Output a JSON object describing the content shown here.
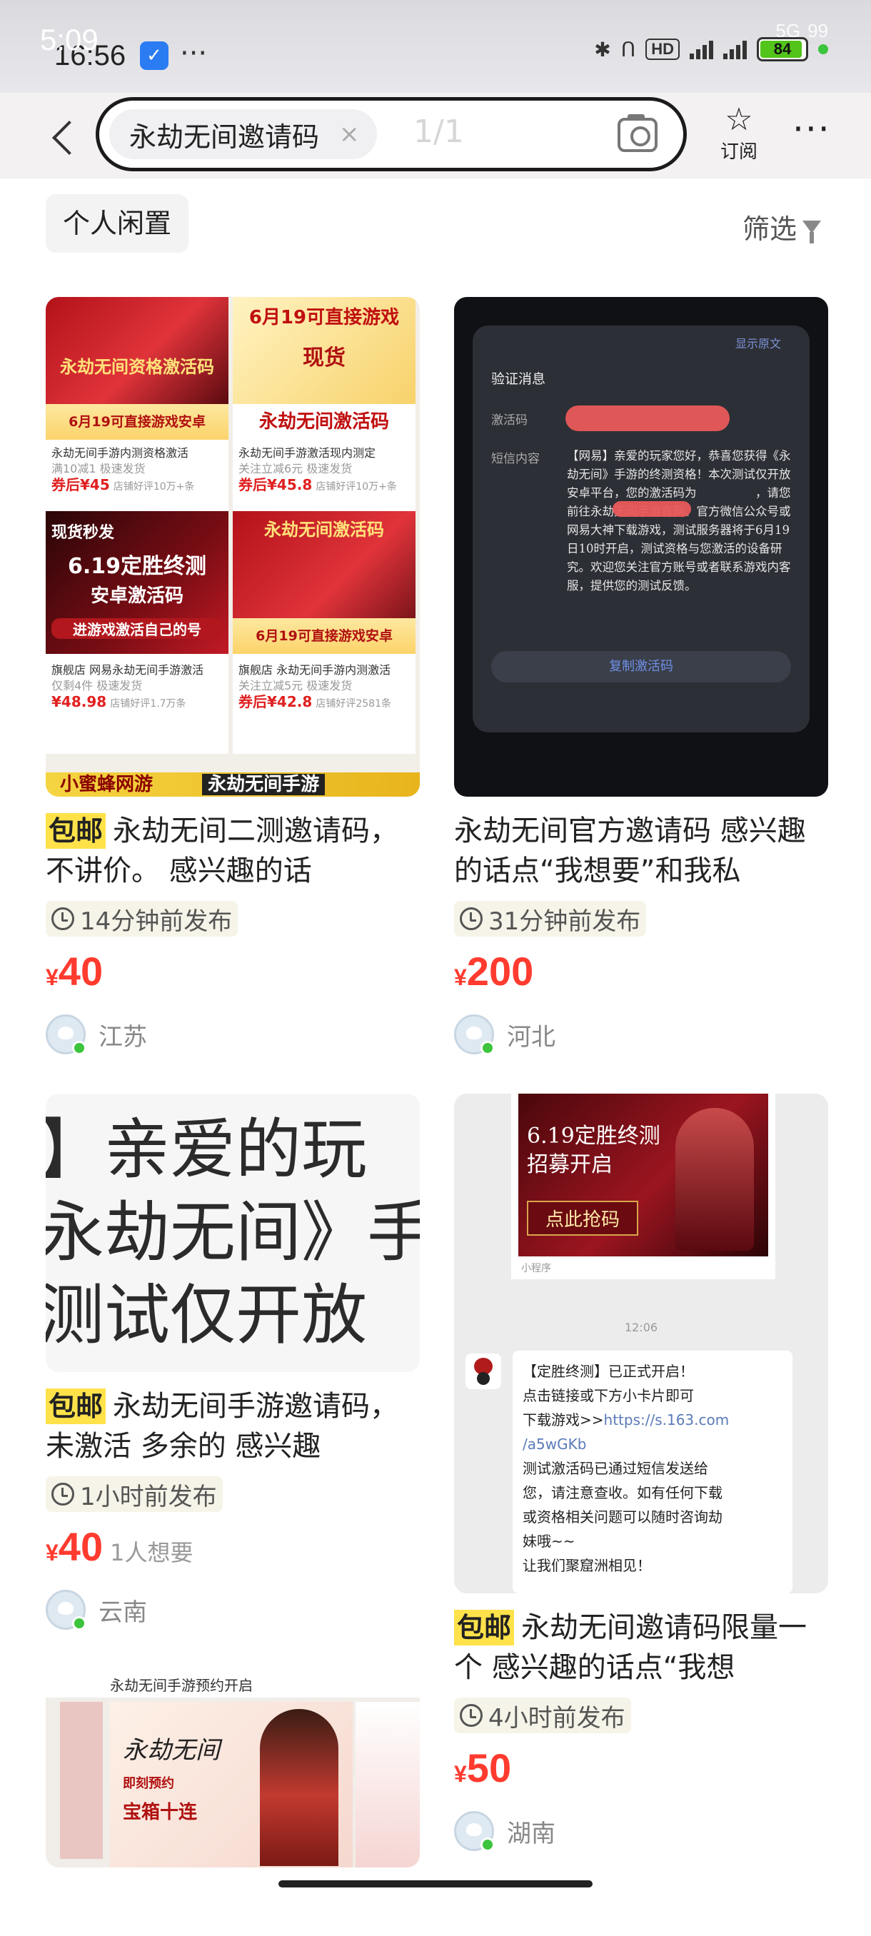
{
  "status_bar": {
    "time_overlay": "5:09",
    "time": "16:56",
    "more": "···",
    "hd": "HD",
    "battery": "84",
    "overlay_5g": "5G",
    "overlay_battery": "99"
  },
  "header": {
    "search_query": "永劫无间邀请码",
    "clear": "×",
    "page_indicator": "1/1",
    "subscribe_label": "订阅",
    "subscribe_icon": "☆",
    "more": "···"
  },
  "filters": {
    "category_chip": "个人闲置",
    "filter_label": "筛选"
  },
  "listings": [
    {
      "free_shipping": "包邮",
      "title": "永劫无间二测邀请码，不讲价。 感兴趣的话",
      "posted": "14分钟前发布",
      "currency": "¥",
      "price": "40",
      "want": "",
      "location": "江苏",
      "image": {
        "tiles": [
          {
            "headline": "永劫无间资格激活码",
            "band": "6月19可直接游戏安卓",
            "desc": "永劫无间手游内测资格激活",
            "meta": "满10减1 极速发货",
            "price": "券后¥45",
            "rating": "店铺好评10万+条"
          },
          {
            "headline": "6月19可直接游戏",
            "headline2": "现货",
            "band": "永劫无间激活码",
            "desc": "永劫无间手游激活现内测定",
            "meta": "关注立减6元 极速发货",
            "price": "券后¥45.8",
            "rating": "店铺好评10万+条"
          },
          {
            "headline": "现货秒发",
            "headline2": "6.19定胜终测",
            "headline3": "安卓激活码",
            "band": "进游戏激活自己的号",
            "desc": "旗舰店 网易永劫无间手游激活",
            "meta": "仅剩4件 极速发货",
            "price": "¥48.98",
            "rating": "店铺好评1.7万条"
          },
          {
            "headline": "永劫无间激活码",
            "band": "6月19可直接游戏安卓",
            "desc": "旗舰店 永劫无间手游内测激活",
            "meta": "关注立减5元 极速发货",
            "price": "券后¥42.8",
            "rating": "店铺好评2581条"
          }
        ],
        "strip_left": "小蜜蜂网游",
        "strip_right": "永劫无间手游"
      }
    },
    {
      "free_shipping": "",
      "title": "永劫无间官方邀请码 感兴趣的话点“我想要”和我私",
      "posted": "31分钟前发布",
      "currency": "¥",
      "price": "200",
      "want": "",
      "location": "河北",
      "image": {
        "corner": "显示原文",
        "dialog_title": "验证消息",
        "label_code": "激活码",
        "label_content": "短信内容",
        "body": "【网易】亲爱的玩家您好，恭喜您获得《永劫无间》手游的终测资格！本次测试仅开放安卓平台，您的激活码为　　　　　，请您前往永劫无间手游官网、官方微信公众号或网易大神下载游戏，测试服务器将于6月19日10时开启，测试资格与您激活的设备研究。欢迎您关注官方账号或者联系游戏内客服，提供您的测试反馈。",
        "copy_button": "复制激活码"
      }
    },
    {
      "free_shipping": "包邮",
      "title": "永劫无间手游邀请码，未激活 多余的 感兴趣",
      "posted": "1小时前发布",
      "currency": "¥",
      "price": "40",
      "want": "1人想要",
      "location": "云南",
      "image": {
        "lines": [
          "】亲爱的玩",
          "永劫无间》手",
          "测试仅开放"
        ]
      }
    },
    {
      "free_shipping": "包邮",
      "title": "永劫无间邀请码限量一个 感兴趣的话点“我想",
      "posted": "4小时前发布",
      "currency": "¥",
      "price": "50",
      "want": "",
      "location": "湖南",
      "image": {
        "poster_line1": "6.19定胜终测",
        "poster_line2": "招募开启",
        "poster_button": "点此抢码",
        "source": "小程序",
        "chat_time": "12:06",
        "bubble_lines": [
          "【定胜终测】已正式开启！",
          "点击链接或下方小卡片即可",
          "下载游戏>>",
          "/a5wGKb",
          "测试激活码已通过短信发送给",
          "您，请注意查收。如有任何下载",
          "或资格相关问题可以随时咨询劫",
          "妹哦~~",
          "让我们聚窟洲相见！"
        ],
        "bubble_link": "https://s.163.com"
      }
    },
    {
      "image": {
        "band": "永劫无间手游预约开启",
        "logo": "永劫无间",
        "sub1": "即刻预约",
        "sub2": "宝箱十连"
      }
    }
  ]
}
